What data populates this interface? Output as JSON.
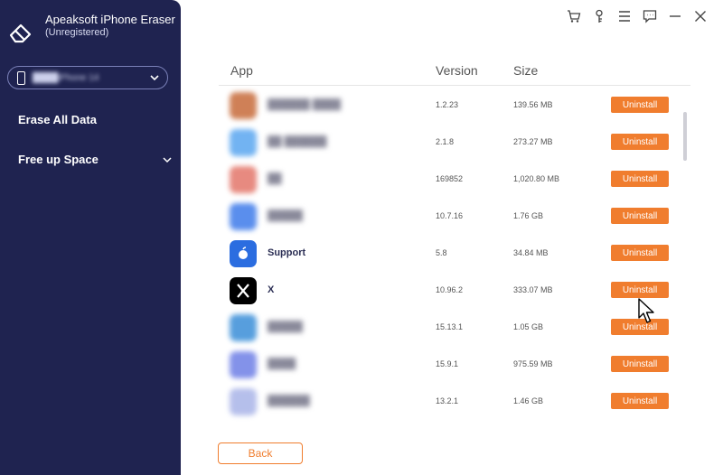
{
  "sidebar": {
    "app_name": "Apeaksoft iPhone Eraser",
    "app_status": "(Unregistered)",
    "device_name": "████iPhone 14",
    "nav": [
      {
        "label": "Erase All Data"
      },
      {
        "label": "Free up Space"
      }
    ]
  },
  "table": {
    "headers": {
      "app": "App",
      "version": "Version",
      "size": "Size"
    },
    "button_label": "Uninstall",
    "rows": [
      {
        "name": "██████ ████",
        "version": "1.2.23",
        "size": "139.56 MB",
        "icon_color": "#c76b3a",
        "blurred": true
      },
      {
        "name": "██ ██████",
        "version": "2.1.8",
        "size": "273.27 MB",
        "icon_color": "#5aa6f0",
        "blurred": true
      },
      {
        "name": "██",
        "version": "169852",
        "size": "1,020.80 MB",
        "icon_color": "#e3766a",
        "blurred": true
      },
      {
        "name": "█████",
        "version": "10.7.16",
        "size": "1.76 GB",
        "icon_color": "#3e7bea",
        "blurred": true
      },
      {
        "name": "Support",
        "version": "5.8",
        "size": "34.84 MB",
        "icon_color": "#2b6de0",
        "blurred": false
      },
      {
        "name": "X",
        "version": "10.96.2",
        "size": "333.07 MB",
        "icon_color": "#000000",
        "blurred": false
      },
      {
        "name": "█████",
        "version": "15.13.1",
        "size": "1.05 GB",
        "icon_color": "#3a8ed8",
        "blurred": true
      },
      {
        "name": "████",
        "version": "15.9.1",
        "size": "975.59 MB",
        "icon_color": "#6e7fe6",
        "blurred": true
      },
      {
        "name": "██████",
        "version": "13.2.1",
        "size": "1.46 GB",
        "icon_color": "#a9b4e8",
        "blurred": true
      }
    ]
  },
  "footer": {
    "back_label": "Back"
  },
  "colors": {
    "sidebar_bg": "#1f2350",
    "accent": "#f07d2e"
  }
}
